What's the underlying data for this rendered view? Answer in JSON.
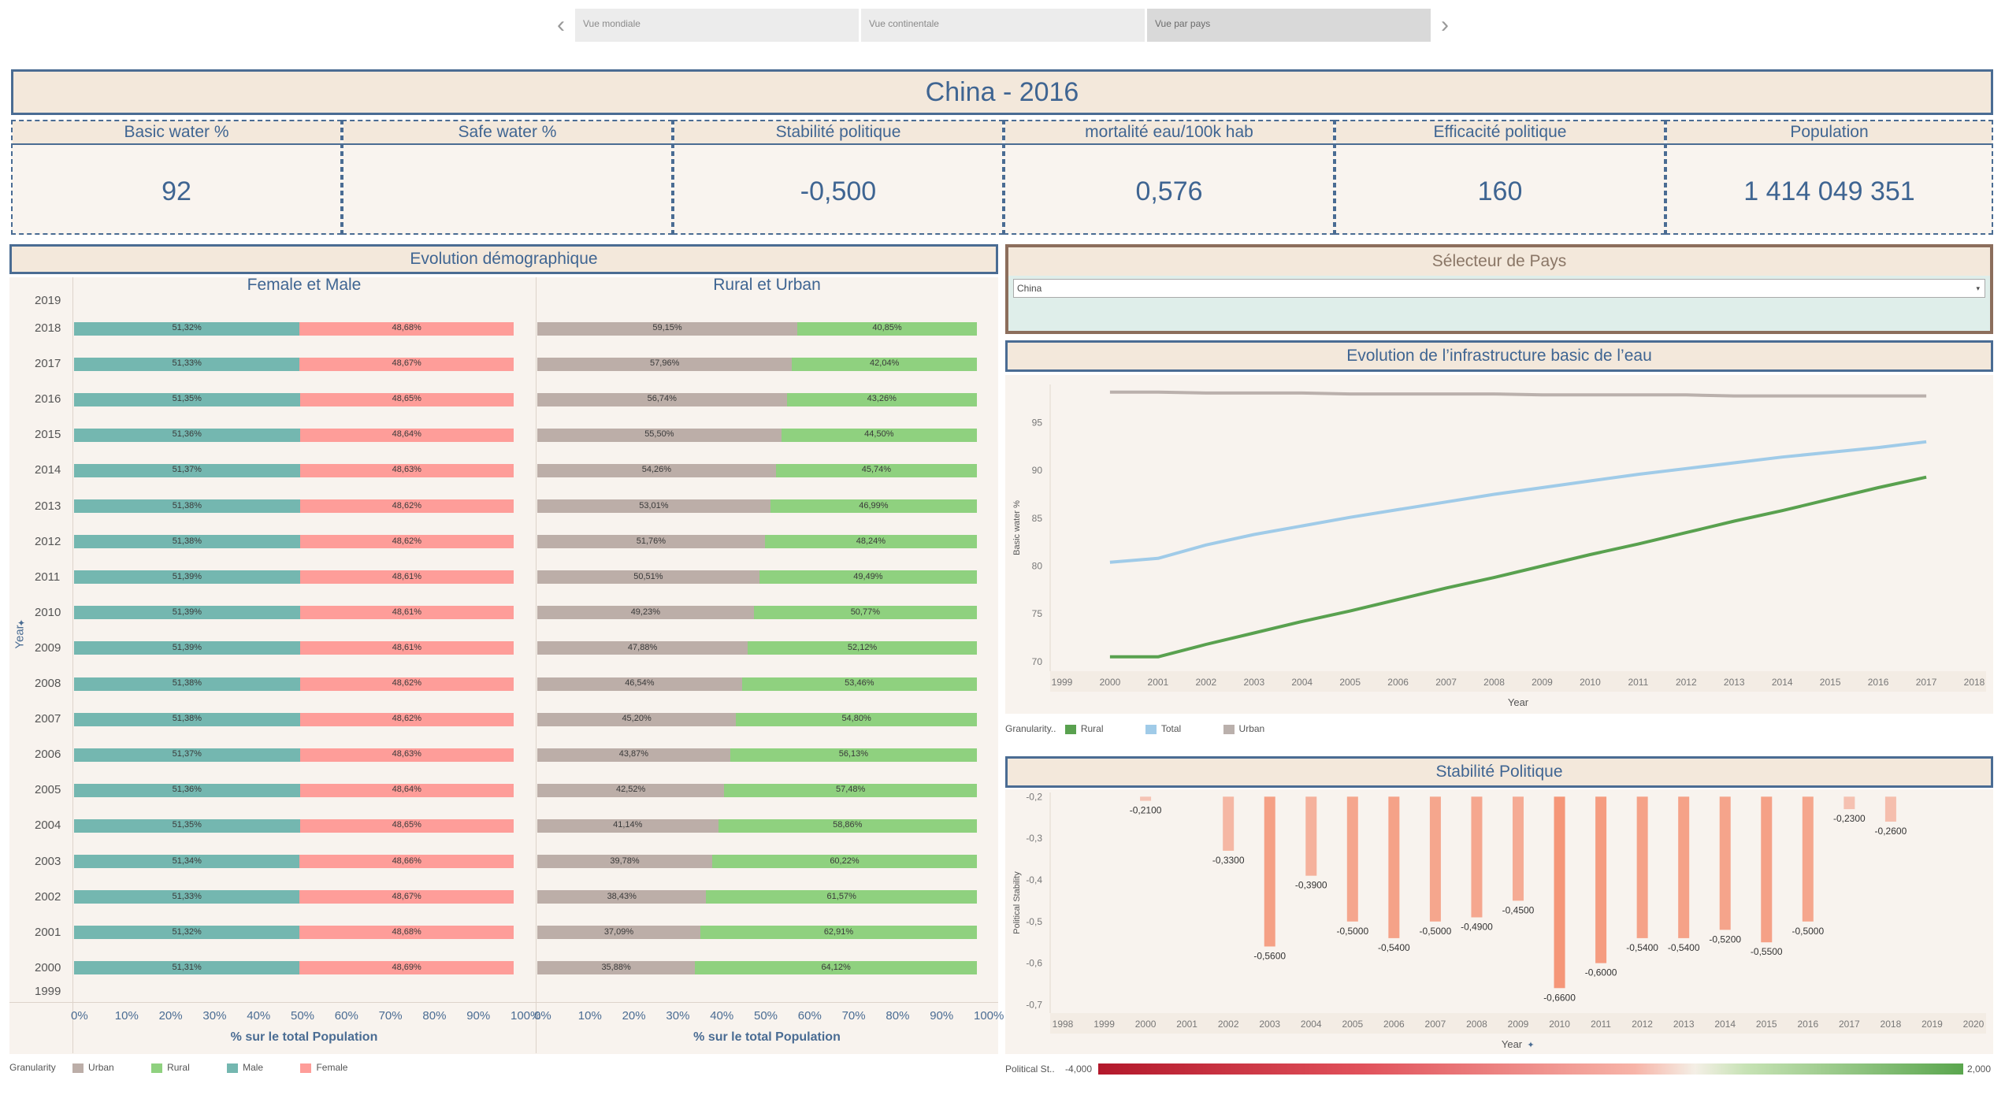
{
  "nav": {
    "tabs": [
      "Vue mondiale",
      "Vue continentale",
      "Vue par pays"
    ],
    "active_tab": "Vue par pays",
    "prev_icon": "chevron-left-icon",
    "next_icon": "chevron-right-icon"
  },
  "title": "China - 2016",
  "kpis": [
    {
      "label": "Basic water %",
      "value": "92"
    },
    {
      "label": "Safe water %",
      "value": ""
    },
    {
      "label": "Stabilité politique",
      "value": "-0,500"
    },
    {
      "label": "mortalité eau/100k hab",
      "value": "0,576"
    },
    {
      "label": "Efficacité politique",
      "value": "160"
    },
    {
      "label": "Population",
      "value": "1 414 049 351"
    }
  ],
  "demo": {
    "header": "Evolution démographique",
    "left_title": "Female et Male",
    "right_title": "Rural et Urban",
    "y_axis_label": "Year",
    "x_axis_label": "% sur le total Population",
    "x_ticks": [
      "0%",
      "10%",
      "20%",
      "30%",
      "40%",
      "50%",
      "60%",
      "70%",
      "80%",
      "90%",
      "100%"
    ],
    "years_extra_top": "2019",
    "years_extra_bottom": "1999",
    "legend_title": "Granularity",
    "legend": [
      {
        "name": "Urban",
        "color": "#bcaea8"
      },
      {
        "name": "Rural",
        "color": "#8fd17f"
      },
      {
        "name": "Male",
        "color": "#74b7b0"
      },
      {
        "name": "Female",
        "color": "#fe9d99"
      }
    ]
  },
  "selector": {
    "header": "Sélecteur de Pays",
    "value": "China"
  },
  "water": {
    "header": "Evolution de l’infrastructure basic de l’eau",
    "legend_title": "Granularity..",
    "legend": [
      {
        "name": "Rural",
        "color": "#59a14f"
      },
      {
        "name": "Total",
        "color": "#a0cbe8"
      },
      {
        "name": "Urban",
        "color": "#bab0ac"
      }
    ]
  },
  "stability": {
    "header": "Stabilité Politique",
    "color_legend_title": "Political St..",
    "color_min": "-4,000",
    "color_max": "2,000"
  },
  "chart_data": [
    {
      "type": "bar",
      "title": "Female et Male",
      "stacked": "100%",
      "orientation": "horizontal",
      "xlabel": "% sur le total Population",
      "ylabel": "Year",
      "categories": [
        "2018",
        "2017",
        "2016",
        "2015",
        "2014",
        "2013",
        "2012",
        "2011",
        "2010",
        "2009",
        "2008",
        "2007",
        "2006",
        "2005",
        "2004",
        "2003",
        "2002",
        "2001",
        "2000"
      ],
      "series": [
        {
          "name": "Male",
          "color": "#74b7b0",
          "labels": [
            "51,32%",
            "51,33%",
            "51,35%",
            "51,36%",
            "51,37%",
            "51,38%",
            "51,38%",
            "51,39%",
            "51,39%",
            "51,39%",
            "51,38%",
            "51,38%",
            "51,37%",
            "51,36%",
            "51,35%",
            "51,34%",
            "51,33%",
            "51,32%",
            "51,31%"
          ],
          "values": [
            51.32,
            51.33,
            51.35,
            51.36,
            51.37,
            51.38,
            51.38,
            51.39,
            51.39,
            51.39,
            51.38,
            51.38,
            51.37,
            51.36,
            51.35,
            51.34,
            51.33,
            51.32,
            51.31
          ]
        },
        {
          "name": "Female",
          "color": "#fe9d99",
          "labels": [
            "48,68%",
            "48,67%",
            "48,65%",
            "48,64%",
            "48,63%",
            "48,62%",
            "48,62%",
            "48,61%",
            "48,61%",
            "48,61%",
            "48,62%",
            "48,62%",
            "48,63%",
            "48,64%",
            "48,65%",
            "48,66%",
            "48,67%",
            "48,68%",
            "48,69%"
          ],
          "values": [
            48.68,
            48.67,
            48.65,
            48.64,
            48.63,
            48.62,
            48.62,
            48.61,
            48.61,
            48.61,
            48.62,
            48.62,
            48.63,
            48.64,
            48.65,
            48.66,
            48.67,
            48.68,
            48.69
          ]
        }
      ]
    },
    {
      "type": "bar",
      "title": "Rural et Urban",
      "stacked": "100%",
      "orientation": "horizontal",
      "xlabel": "% sur le total Population",
      "categories": [
        "2018",
        "2017",
        "2016",
        "2015",
        "2014",
        "2013",
        "2012",
        "2011",
        "2010",
        "2009",
        "2008",
        "2007",
        "2006",
        "2005",
        "2004",
        "2003",
        "2002",
        "2001",
        "2000"
      ],
      "series": [
        {
          "name": "Urban",
          "color": "#bcaea8",
          "labels": [
            "59,15%",
            "57,96%",
            "56,74%",
            "55,50%",
            "54,26%",
            "53,01%",
            "51,76%",
            "50,51%",
            "49,23%",
            "47,88%",
            "46,54%",
            "45,20%",
            "43,87%",
            "42,52%",
            "41,14%",
            "39,78%",
            "38,43%",
            "37,09%",
            "35,88%"
          ],
          "values": [
            59.15,
            57.96,
            56.74,
            55.5,
            54.26,
            53.01,
            51.76,
            50.51,
            49.23,
            47.88,
            46.54,
            45.2,
            43.87,
            42.52,
            41.14,
            39.78,
            38.43,
            37.09,
            35.88
          ]
        },
        {
          "name": "Rural",
          "color": "#8fd17f",
          "labels": [
            "40,85%",
            "42,04%",
            "43,26%",
            "44,50%",
            "45,74%",
            "46,99%",
            "48,24%",
            "49,49%",
            "50,77%",
            "52,12%",
            "53,46%",
            "54,80%",
            "56,13%",
            "57,48%",
            "58,86%",
            "60,22%",
            "61,57%",
            "62,91%",
            "64,12%"
          ],
          "values": [
            40.85,
            42.04,
            43.26,
            44.5,
            45.74,
            46.99,
            48.24,
            49.49,
            50.77,
            52.12,
            53.46,
            54.8,
            56.13,
            57.48,
            58.86,
            60.22,
            61.57,
            62.91,
            64.12
          ]
        }
      ]
    },
    {
      "type": "line",
      "xlabel": "Year",
      "ylabel": "Basic water %",
      "x_ticks": [
        "1999",
        "2000",
        "2001",
        "2002",
        "2003",
        "2004",
        "2005",
        "2006",
        "2007",
        "2008",
        "2009",
        "2010",
        "2011",
        "2012",
        "2013",
        "2014",
        "2015",
        "2016",
        "2017",
        "2018"
      ],
      "y_ticks": [
        70,
        75,
        80,
        85,
        90,
        95
      ],
      "xlim": [
        1999,
        2018
      ],
      "ylim": [
        69,
        99
      ],
      "x": [
        2000,
        2001,
        2002,
        2003,
        2004,
        2005,
        2006,
        2007,
        2008,
        2009,
        2010,
        2011,
        2012,
        2013,
        2014,
        2015,
        2016,
        2017
      ],
      "series": [
        {
          "name": "Urban",
          "color": "#bab0ac",
          "values": [
            98.2,
            98.2,
            98.1,
            98.1,
            98.1,
            98.0,
            98.0,
            98.0,
            98.0,
            97.9,
            97.9,
            97.9,
            97.9,
            97.8,
            97.8,
            97.8,
            97.8,
            97.8
          ]
        },
        {
          "name": "Total",
          "color": "#a0cbe8",
          "values": [
            80.4,
            80.8,
            82.2,
            83.3,
            84.2,
            85.1,
            85.9,
            86.7,
            87.5,
            88.2,
            88.9,
            89.6,
            90.2,
            90.8,
            91.4,
            91.9,
            92.4,
            93.0
          ]
        },
        {
          "name": "Rural",
          "color": "#59a14f",
          "values": [
            70.5,
            70.5,
            71.8,
            73.0,
            74.2,
            75.3,
            76.5,
            77.7,
            78.8,
            80.0,
            81.2,
            82.3,
            83.5,
            84.7,
            85.8,
            87.0,
            88.2,
            89.3
          ]
        }
      ]
    },
    {
      "type": "bar",
      "xlabel": "Year",
      "ylabel": "Political Stability",
      "x_ticks": [
        "1998",
        "1999",
        "2000",
        "2001",
        "2002",
        "2003",
        "2004",
        "2005",
        "2006",
        "2007",
        "2008",
        "2009",
        "2010",
        "2011",
        "2012",
        "2013",
        "2014",
        "2015",
        "2016",
        "2017",
        "2018",
        "2019",
        "2020"
      ],
      "y_ticks": [
        "-0,2",
        "-0,3",
        "-0,4",
        "-0,5",
        "-0,6",
        "-0,7"
      ],
      "ylim": [
        -0.72,
        -0.19
      ],
      "categories": [
        "2000",
        "2002",
        "2003",
        "2004",
        "2005",
        "2006",
        "2007",
        "2008",
        "2009",
        "2010",
        "2011",
        "2012",
        "2013",
        "2014",
        "2015",
        "2016",
        "2017",
        "2018"
      ],
      "values": [
        -0.21,
        -0.33,
        -0.56,
        -0.39,
        -0.5,
        -0.54,
        -0.5,
        -0.49,
        -0.45,
        -0.66,
        -0.6,
        -0.54,
        -0.54,
        -0.52,
        -0.55,
        -0.5,
        -0.23,
        -0.26
      ],
      "labels": [
        "-0,2100",
        "-0,3300",
        "-0,5600",
        "-0,3900",
        "-0,5000",
        "-0,5400",
        "-0,5000",
        "-0,4900",
        "-0,4500",
        "-0,6600",
        "-0,6000",
        "-0,5400",
        "-0,5400",
        "-0,5200",
        "-0,5500",
        "-0,5000",
        "-0,2300",
        "-0,2600"
      ]
    }
  ]
}
